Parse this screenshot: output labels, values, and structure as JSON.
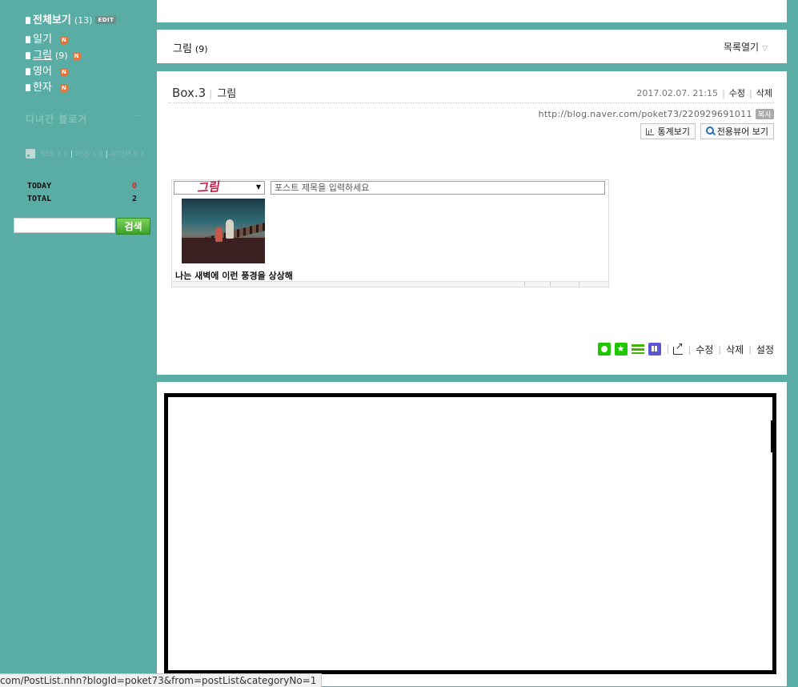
{
  "sidebar": {
    "all_label": "전체보기",
    "all_count": "(13)",
    "edit_badge": "EDIT",
    "categories": [
      {
        "label": "일기",
        "count": "",
        "badge": "N"
      },
      {
        "label": "그림",
        "count": "(9)",
        "badge": "N"
      },
      {
        "label": "영어",
        "count": "",
        "badge": "N"
      },
      {
        "label": "한자",
        "count": "",
        "badge": "N"
      }
    ],
    "visited_title": "다녀간 블로거",
    "visited_more": "···",
    "rss_links": [
      "RSS 2.0",
      "RSS 1.0",
      "ATOM 0.3"
    ],
    "today_label": "TODAY",
    "today_value": "0",
    "total_label": "TOTAL",
    "total_value": "2",
    "search_placeholder": "",
    "search_button": "검색"
  },
  "list_header": {
    "title": "그림",
    "count": "(9)",
    "toggle": "목록열기"
  },
  "post": {
    "title": "Box.3",
    "category": "그림",
    "date": "2017.02.07. 21:15",
    "edit": "수정",
    "delete": "삭제",
    "url": "http://blog.naver.com/poket73/220929691011",
    "copy": "복사",
    "stats_button": "통계보기",
    "viewer_button": "전용뷰어 보기",
    "embed": {
      "select_text": "그림",
      "title_placeholder": "포스트 제목을 입력하세요",
      "caption": "나는 새벽에 이런 풍경을 상상해"
    },
    "actions": {
      "edit": "수정",
      "delete": "삭제",
      "settings": "설정"
    }
  },
  "status_bar": {
    "url": "com/PostList.nhn?blogId=poket73&from=postList&categoryNo=1"
  }
}
